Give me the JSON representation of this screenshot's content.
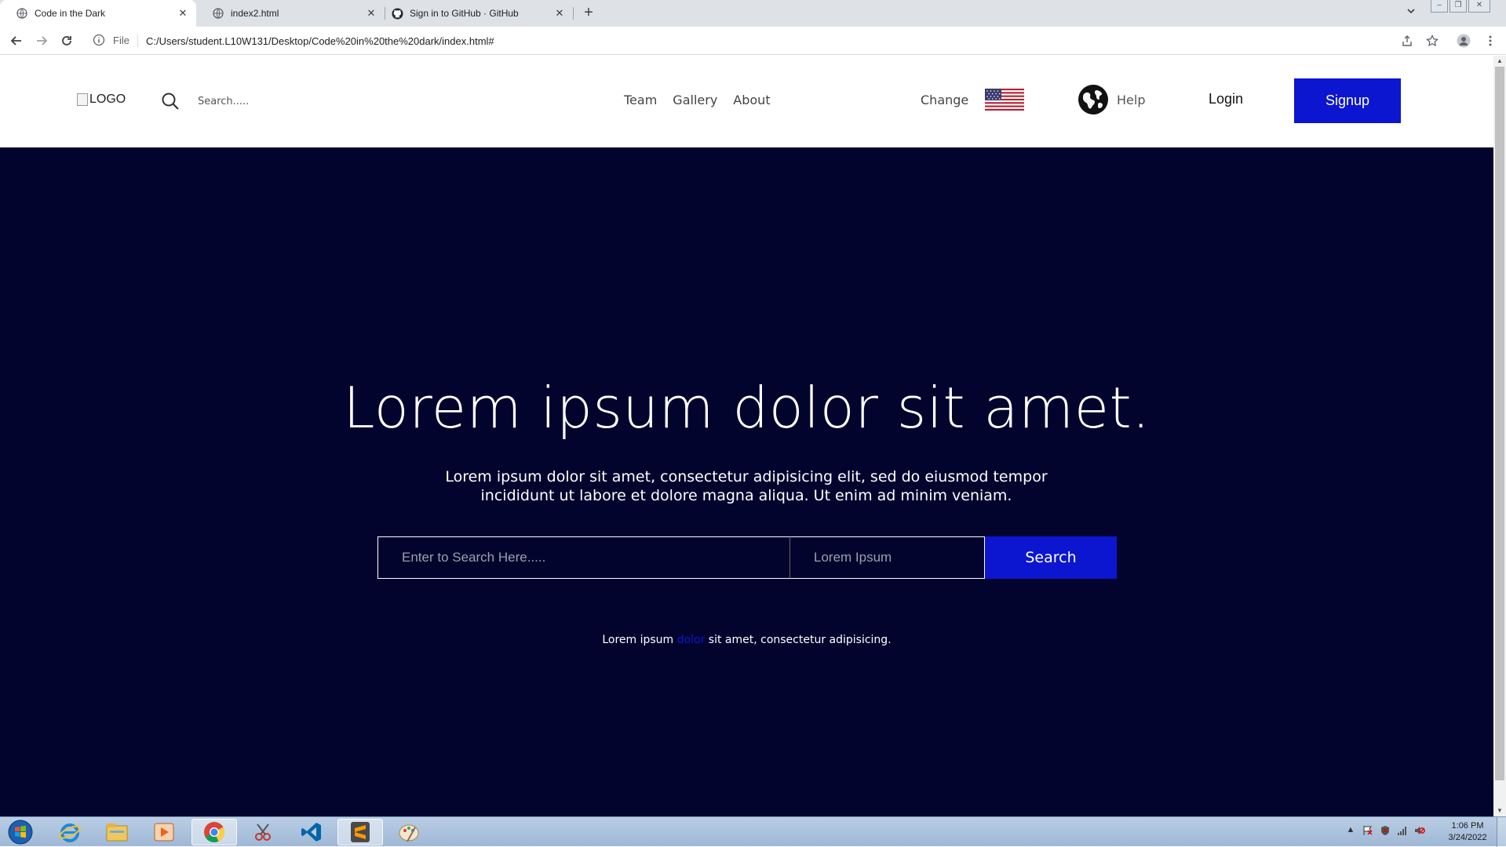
{
  "browser": {
    "tabs": [
      {
        "title": "Code in the Dark",
        "active": true
      },
      {
        "title": "index2.html",
        "active": false
      },
      {
        "title": "Sign in to GitHub · GitHub",
        "active": false
      }
    ],
    "address": {
      "scheme_label": "File",
      "url": "C:/Users/student.L10W131/Desktop/Code%20in%20the%20dark/index.html#"
    }
  },
  "header": {
    "logo_alt": "LOGO",
    "search_placeholder": "Search.....",
    "nav": [
      "Team",
      "Gallery",
      "About"
    ],
    "change_label": "Change",
    "help_label": "Help",
    "login_label": "Login",
    "signup_label": "Signup"
  },
  "hero": {
    "title": "Lorem ipsum dolor sit amet.",
    "subtitle": "Lorem ipsum dolor sit amet, consectetur adipisicing elit, sed do eiusmod tempor incididunt ut labore et dolore magna aliqua. Ut enim ad minim veniam.",
    "search_placeholder": "Enter to Search Here.....",
    "location_placeholder": "Lorem Ipsum",
    "search_button": "Search",
    "note_before": "Lorem ipsum ",
    "note_highlight": "dolor",
    "note_after": " sit amet, consectetur adipisicing."
  },
  "colors": {
    "hero_bg": "#03042e",
    "accent_blue": "#0c16d0"
  },
  "taskbar": {
    "clock_time": "1:06 PM",
    "clock_date": "3/24/2022"
  }
}
